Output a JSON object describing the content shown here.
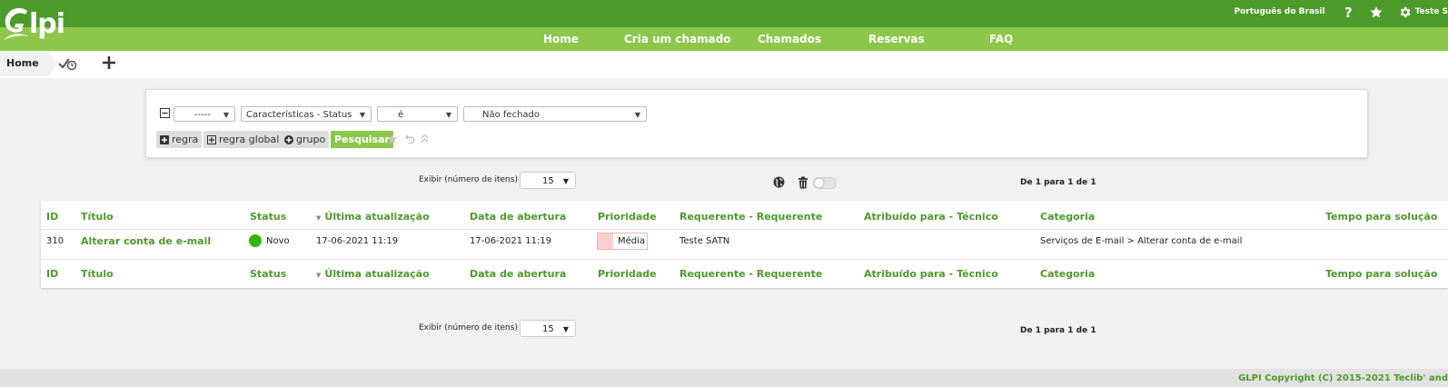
{
  "brand": {
    "logo_text": "lpi"
  },
  "topbar": {
    "language": "Português do Brasil",
    "user": "Teste S",
    "icons": [
      "help-icon",
      "star-icon",
      "gear-icon"
    ]
  },
  "nav": {
    "items": [
      "Home",
      "Cria um chamado",
      "Chamados",
      "Reservas",
      "FAQ"
    ]
  },
  "breadcrumb": {
    "home": "Home"
  },
  "search": {
    "link_select": "-----",
    "field_select": "Características - Status",
    "operator_select": "é",
    "value_select": "Não fechado",
    "buttons": {
      "rule": "regra",
      "global_rule": "regra global",
      "group": "grupo",
      "search": "Pesquisar"
    }
  },
  "pager": {
    "label": "Exibir (número de itens)",
    "value": "15",
    "info": "De 1 para 1 de 1"
  },
  "table": {
    "columns": [
      "ID",
      "Título",
      "Status",
      "Última atualização",
      "Data de abertura",
      "Prioridade",
      "Requerente - Requerente",
      "Atribuído para - Técnico",
      "Categoria",
      "Tempo para solução"
    ],
    "rows": [
      {
        "id": "310",
        "title": "Alterar conta de e-mail",
        "status": "Novo",
        "updated": "17-06-2021 11:19",
        "opened": "17-06-2021 11:19",
        "priority": "Média",
        "requester": "Teste SATN",
        "assigned": "",
        "category": "Serviços de E-mail > Alterar conta de e-mail",
        "solve_time": ""
      }
    ]
  },
  "colors": {
    "green_dark": "#4c9a2a",
    "green_light": "#8cc74a",
    "status_new": "#3bb30b",
    "priority_medium": "#ffcfcf"
  },
  "footer": {
    "text": "GLPI Copyright (C) 2015-2021 Teclib' and"
  }
}
